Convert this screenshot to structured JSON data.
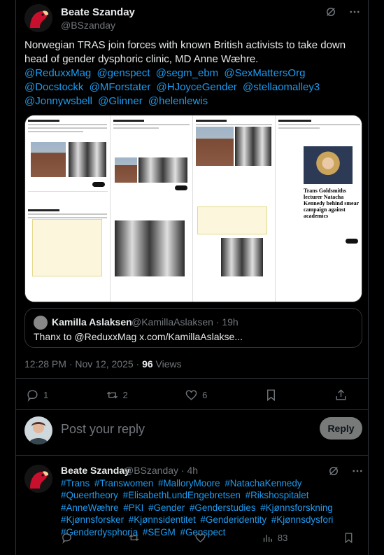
{
  "tweet": {
    "author_name": "Beate Szanday",
    "author_handle": "@BSzanday",
    "text": "Norwegian TRAS join forces with known British activists to take down head of gender dysphoric clinic, MD Anne Wæhre.",
    "mentions": [
      "@ReduxxMag",
      "@genspect",
      "@segm_ebm",
      "@SexMattersOrg",
      "@Docstockk",
      "@MForstater",
      "@HJoyceGender",
      "@stellaomalley3",
      "@Jonnywsbell",
      "@Glinner",
      "@helenlewis"
    ],
    "media_headline": "Trans Goldsmiths lecturer Natacha Kennedy behind smear campaign against academics",
    "quote": {
      "name": "Kamilla Aslaksen",
      "handle": "@KamillaAslaksen · 19h",
      "text": "Thanx to @ReduxxMag x.com/KamillaAslakse..."
    },
    "timestamp": "12:28 PM · Nov 12, 2025 · ",
    "views_count": "96",
    "views_label": " Views",
    "counts": {
      "replies": "1",
      "reposts": "2",
      "likes": "6"
    }
  },
  "reply_box": {
    "placeholder": "Post your reply",
    "button_label": "Reply"
  },
  "reply_tweet": {
    "author_name": "Beate Szanday",
    "author_handle": "@BSzanday · 4h",
    "hashtags": [
      "#Trans",
      "#Transwomen",
      "#MalloryMoore",
      "#NatachaKennedy",
      "#Queertheory",
      "#ElisabethLundEngebretsen",
      "#Rikshospitalet",
      "#AnneWæhre",
      "#PKI",
      "#Gender",
      "#Genderstudies",
      "#Kjønnsforskning",
      "#Kjønnsforsker",
      "#Kjønnsidentitet",
      "#Genderidentity",
      "#Kjønnsdysfori",
      "#Genderdysphoria",
      "#SEGM",
      "#Genspect"
    ],
    "views": "83"
  },
  "colors": {
    "accent": "#1d9bf0",
    "muted": "#71767b",
    "border": "#2f3336"
  }
}
